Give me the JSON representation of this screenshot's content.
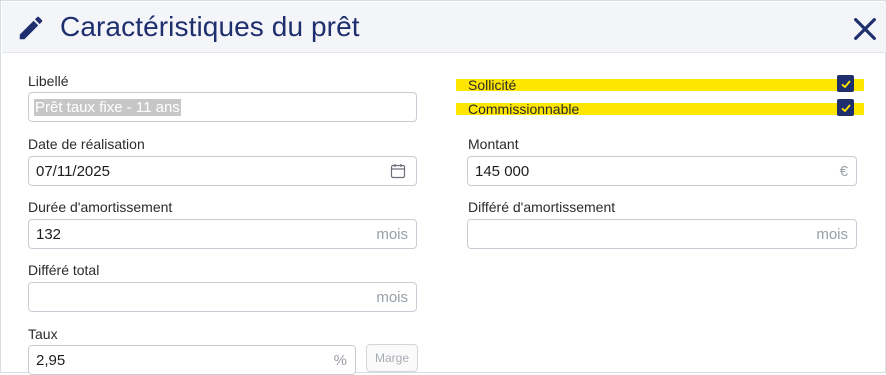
{
  "header": {
    "title": "Caractéristiques du prêt",
    "edit_icon": "pencil-icon",
    "close_icon": "close-icon"
  },
  "left": {
    "libelle": {
      "label": "Libellé",
      "value": "Prêt taux fixe - 11 ans"
    },
    "date_realisation": {
      "label": "Date de réalisation",
      "value": "07/11/2025",
      "icon": "calendar-icon"
    },
    "duree_amortissement": {
      "label": "Durée d'amortissement",
      "value": "132",
      "suffix": "mois"
    },
    "differe_total": {
      "label": "Différé total",
      "value": "",
      "suffix": "mois"
    },
    "taux": {
      "label": "Taux",
      "value": "2,95",
      "suffix": "%",
      "button": "Marge"
    }
  },
  "right": {
    "sollicite": {
      "label": "Sollicité",
      "checked": true
    },
    "commissionnable": {
      "label": "Commissionnable",
      "checked": true
    },
    "montant": {
      "label": "Montant",
      "value": "145 000",
      "suffix": "€"
    },
    "differe_amortissement": {
      "label": "Différé d'amortissement",
      "value": "",
      "suffix": "mois"
    }
  },
  "colors": {
    "brand": "#1f2f6e",
    "highlight": "#ffe600",
    "border": "#c9ced6"
  }
}
